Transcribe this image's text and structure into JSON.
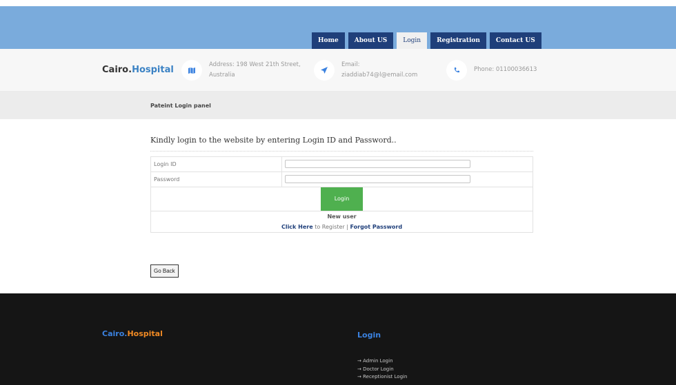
{
  "nav": [
    {
      "label": "Home",
      "active": false
    },
    {
      "label": "About US",
      "active": false
    },
    {
      "label": "Login",
      "active": true
    },
    {
      "label": "Registration",
      "active": false
    },
    {
      "label": "Contact US",
      "active": false
    }
  ],
  "brand": {
    "part1": "Cairo.",
    "part2": "Hospital"
  },
  "info": {
    "address_line1": "Address: 198 West 21th Street,",
    "address_line2": "Australia",
    "email_line1": "Email:",
    "email_line2": "ziaddiab74@l@email.com",
    "phone": "Phone: 01100036613",
    "address_icon": "map-icon",
    "email_icon": "paper-plane-icon",
    "phone_icon": "phone-icon"
  },
  "panel": {
    "title": "Pateint Login panel"
  },
  "form": {
    "heading": "Kindly login to the website by entering Login ID and Password..",
    "login_id_label": "Login ID",
    "login_id_value": "",
    "password_label": "Password",
    "password_value": "",
    "login_button": "Login",
    "new_user": "New user",
    "click_here": "Click Here",
    "to_register": " to Register | ",
    "forgot_password": "Forgot Password"
  },
  "go_back": "Go Back",
  "footer": {
    "brand_part1": "Cairo.",
    "brand_part2": "Hospital",
    "login_heading": "Login",
    "links": [
      "→ Admin Login",
      "→ Doctor Login",
      "→ Receptionist Login"
    ]
  },
  "colors": {
    "topbar": "#7aabdc",
    "nav": "#1f3f7a",
    "login_button": "#4fb04f",
    "footer": "#151515",
    "brand_accent": "#f08a24"
  }
}
